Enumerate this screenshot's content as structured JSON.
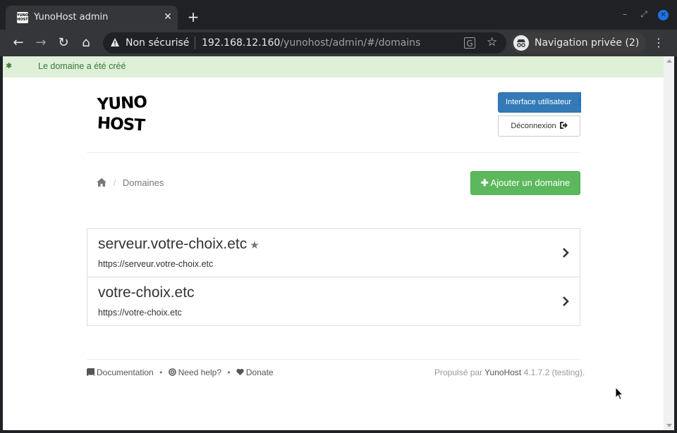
{
  "browser": {
    "tab_title": "YunoHost admin",
    "favicon_text": "YUNO HOST",
    "security_label": "Non sécurisé",
    "url_host": "192.168.12.160",
    "url_path": "/yunohost/admin/#/domains",
    "incognito_label": "Navigation privée (2)",
    "accent_color": "#1a73e8"
  },
  "alert": {
    "message": "Le domaine a été créé",
    "color": "#dff0d8"
  },
  "header": {
    "logo_text": "YUNO HOST",
    "user_interface_label": "Interface utilisateur",
    "logout_label": "Déconnexion"
  },
  "breadcrumb": {
    "current": "Domaines"
  },
  "actions": {
    "add_domain_label": "Ajouter un domaine"
  },
  "domains": [
    {
      "name": "serveur.votre-choix.etc",
      "url": "https://serveur.votre-choix.etc",
      "is_main": true
    },
    {
      "name": "votre-choix.etc",
      "url": "https://votre-choix.etc",
      "is_main": false
    }
  ],
  "footer": {
    "documentation": "Documentation",
    "help": "Need help?",
    "donate": "Donate",
    "powered_prefix": "Propulsé par",
    "product": "YunoHost",
    "version": "4.1.7.2 (testing)."
  },
  "icons": {
    "home": "home-icon",
    "star": "star-icon",
    "chevron": "chevron-right-icon",
    "plus": "plus-icon",
    "user": "user-icon",
    "logout": "sign-out-icon",
    "book": "book-icon",
    "lifebuoy": "life-ring-icon",
    "heart": "heart-icon"
  }
}
